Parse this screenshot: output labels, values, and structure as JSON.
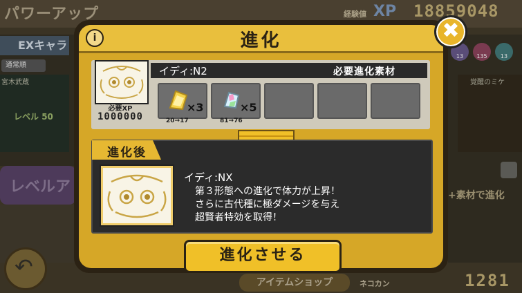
{
  "background": {
    "title": "パワーアップ",
    "xp_label": "経験値",
    "xp_icon": "XP",
    "xp_value": "18859048",
    "ex_tab": "EXキャラ",
    "filter": "通常順",
    "left_card_name": "宮木武蔵",
    "left_card_level_label": "レベル",
    "left_card_level": "50",
    "level_up_button": "レベルア",
    "right_card_name": "覚醒のミケ",
    "gem_counts": [
      "13",
      "135",
      "13"
    ],
    "right_hint": "+素材で進化",
    "back_icon": "back-arrow-icon",
    "shop_button": "アイテムショップ",
    "neko_label": "ネコカン",
    "neko_value": "1281"
  },
  "dialog": {
    "title": "進化",
    "info_icon": "i",
    "close_icon": "✖",
    "unit_name": "イディ:N2",
    "required_materials_label": "必要進化素材",
    "xp_required_label": "必要XP",
    "xp_required_value": "1000000",
    "materials": [
      {
        "qty": "×3",
        "count": "20→17",
        "icon": "gold-catfruit-icon"
      },
      {
        "qty": "×5",
        "count": "81→76",
        "icon": "rainbow-catfruit-icon"
      }
    ],
    "after_label": "進化後",
    "evolved_name": "イディ:NX",
    "evolved_desc": [
      "第３形態への進化で体力が上昇！",
      "さらに古代種に極ダメージを与え",
      "超賢者特効を取得！"
    ],
    "evolve_button": "進化させる"
  },
  "colors": {
    "dialog_gold": "#d6a727",
    "button_gold": "#f0c028",
    "dark_panel": "#2b2b2b"
  }
}
